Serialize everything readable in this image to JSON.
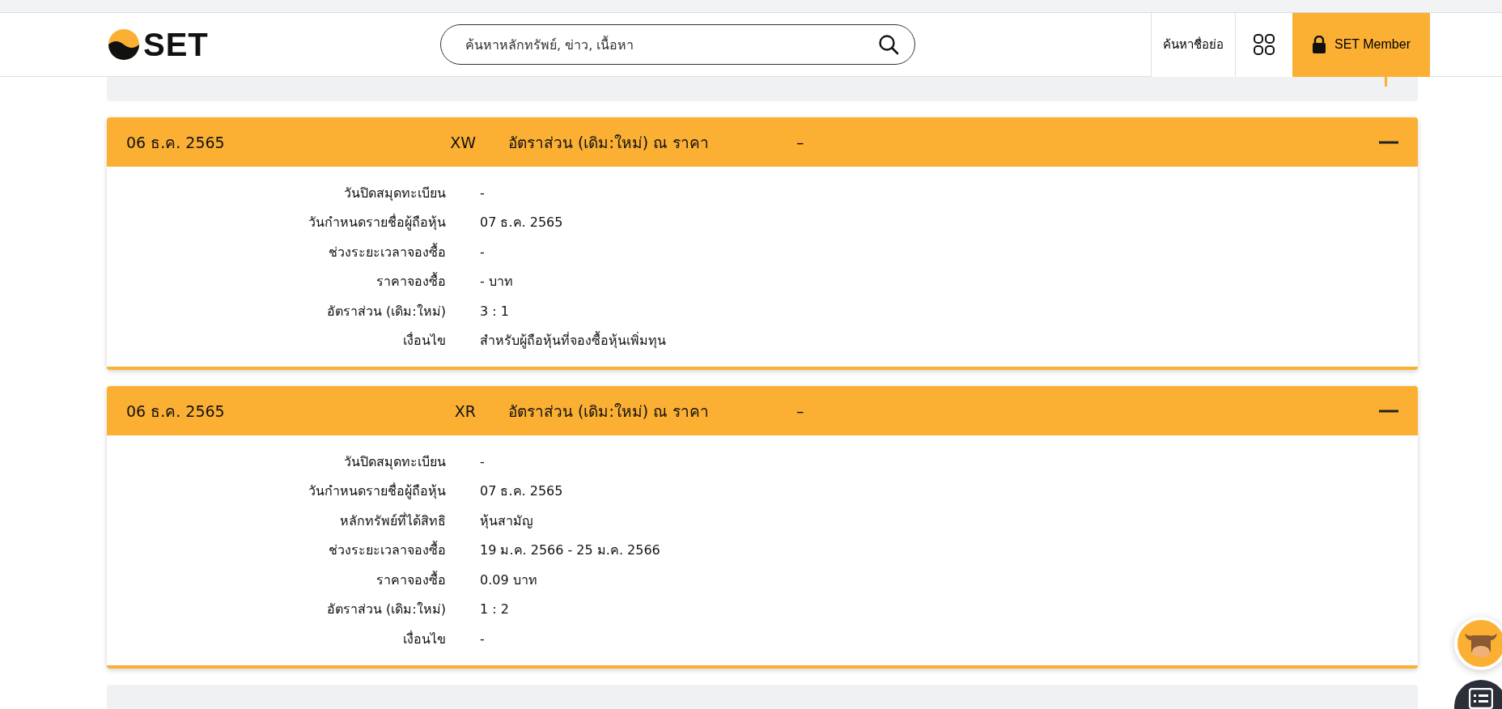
{
  "header": {
    "logo_text": "SET",
    "search": {
      "placeholder": "ค้นหาหลักทรัพย์, ข่าว, เนื้อหา"
    },
    "symbol_search": "ค้นหาชื่อย่อ",
    "member_button": "SET Member"
  },
  "events": [
    {
      "date": "06 ธ.ค. 2565",
      "code": "XW",
      "title": "อัตราส่วน (เดิม:ใหม่) ณ ราคา",
      "value": "–",
      "expanded": true,
      "details": [
        {
          "label": "วันปิดสมุดทะเบียน",
          "value": "-"
        },
        {
          "label": "วันกำหนดรายชื่อผู้ถือหุ้น",
          "value": "07 ธ.ค. 2565"
        },
        {
          "label": "ช่วงระยะเวลาจองซื้อ",
          "value": "-"
        },
        {
          "label": "ราคาจองซื้อ",
          "value": "- บาท"
        },
        {
          "label": "อัตราส่วน (เดิม:ใหม่)",
          "value": "3 : 1"
        },
        {
          "label": "เงื่อนไข",
          "value": "สำหรับผู้ถือหุ้นที่จองซื้อหุ้นเพิ่มทุน"
        }
      ]
    },
    {
      "date": "06 ธ.ค. 2565",
      "code": "XR",
      "title": "อัตราส่วน (เดิม:ใหม่) ณ ราคา",
      "value": "–",
      "expanded": true,
      "details": [
        {
          "label": "วันปิดสมุดทะเบียน",
          "value": "-"
        },
        {
          "label": "วันกำหนดรายชื่อผู้ถือหุ้น",
          "value": "07 ธ.ค. 2565"
        },
        {
          "label": "หลักทรัพย์ที่ได้สิทธิ",
          "value": "หุ้นสามัญ"
        },
        {
          "label": "ช่วงระยะเวลาจองซื้อ",
          "value": "19 ม.ค. 2566 - 25 ม.ค. 2566"
        },
        {
          "label": "ราคาจองซื้อ",
          "value": "0.09 บาท"
        },
        {
          "label": "อัตราส่วน (เดิม:ใหม่)",
          "value": "1 : 2"
        },
        {
          "label": "เงื่อนไข",
          "value": "-"
        }
      ]
    }
  ]
}
